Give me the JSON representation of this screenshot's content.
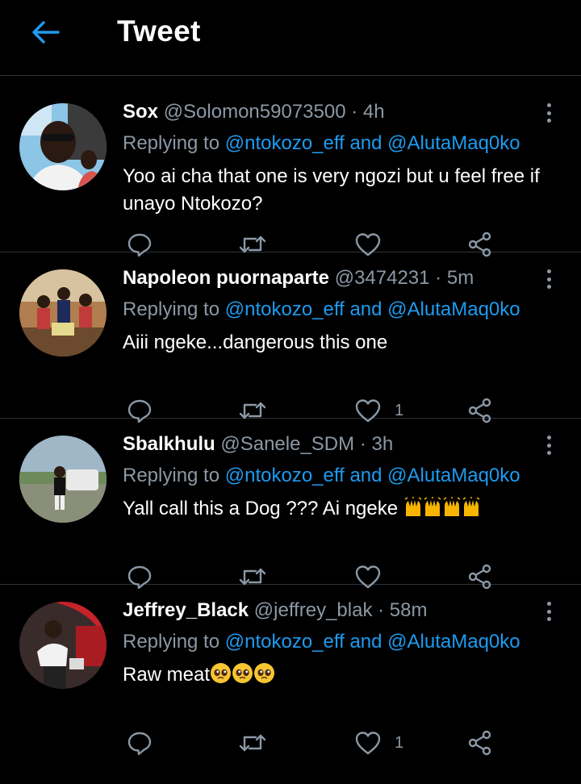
{
  "header": {
    "title": "Tweet"
  },
  "tweets": [
    {
      "name": "Sox",
      "handle": "@Solomon59073500",
      "dot": "·",
      "time": "4h",
      "replying_prefix": "Replying to",
      "mention1": "@ntokozo_eff",
      "and": "and",
      "mention2": "@AlutaMaq0ko",
      "text": "Yoo ai cha that one is very ngozi but u feel free if unayo Ntokozo?",
      "likes": ""
    },
    {
      "name": "Napoleon puornaparte",
      "handle": "@3474231",
      "dot": "·",
      "time": "5m",
      "replying_prefix": "Replying to",
      "mention1": "@ntokozo_eff",
      "and": "and",
      "mention2": "@AlutaMaq0ko",
      "text": "Aiii ngeke...dangerous this one",
      "likes": "1"
    },
    {
      "name": "Sbalkhulu",
      "handle": "@Sanele_SDM",
      "dot": "·",
      "time": "3h",
      "replying_prefix": "Replying to",
      "mention1": "@ntokozo_eff",
      "and": "and",
      "mention2": "@AlutaMaq0ko",
      "text": "Yall call this a Dog ??? Ai ngeke ",
      "emoji_count": 4,
      "likes": ""
    },
    {
      "name": "Jeffrey_Black",
      "handle": "@jeffrey_blak",
      "dot": "·",
      "time": "58m",
      "replying_prefix": "Replying to",
      "mention1": "@ntokozo_eff",
      "and": "and",
      "mention2": "@AlutaMaq0ko",
      "text": "Raw meat",
      "emoji_count": 3,
      "likes": "1"
    }
  ],
  "colors": {
    "accent": "#1d9bf0",
    "muted": "#8b98a5",
    "divider": "#2f3336",
    "background": "#000000"
  },
  "icons": [
    "back-arrow-icon",
    "more-vertical-icon",
    "reply-icon",
    "retweet-icon",
    "heart-icon",
    "share-icon",
    "raising-hands-emoji",
    "pleading-face-emoji"
  ]
}
